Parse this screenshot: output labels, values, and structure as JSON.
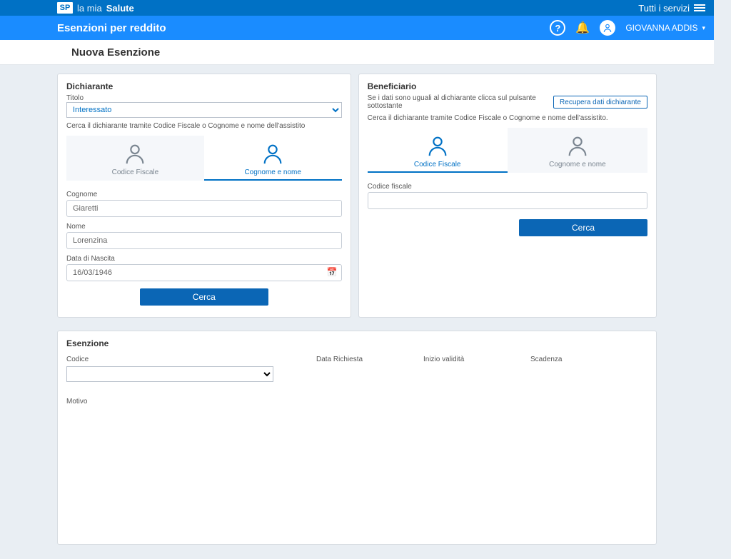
{
  "topbar": {
    "logo_text": "SP",
    "brand_a": "la mia",
    "brand_b": "Salute",
    "all_services": "Tutti i servizi"
  },
  "header": {
    "app_title": "Esenzioni per reddito",
    "user_name": "GIOVANNA ADDIS"
  },
  "subheader": {
    "title": "Nuova Esenzione"
  },
  "dichiarante": {
    "heading": "Dichiarante",
    "titolo_label": "Titolo",
    "titolo_value": "Interessato",
    "search_hint": "Cerca il dichiarante tramite Codice Fiscale o Cognome e nome dell'assistito",
    "tab_cf": "Codice Fiscale",
    "tab_nome": "Cognome e nome",
    "cognome_label": "Cognome",
    "cognome_value": "Giaretti",
    "nome_label": "Nome",
    "nome_value": "Lorenzina",
    "data_nascita_label": "Data di Nascita",
    "data_nascita_value": "16/03/1946",
    "cerca_label": "Cerca"
  },
  "beneficiario": {
    "heading": "Beneficiario",
    "same_hint": "Se i dati sono uguali al dichiarante clicca sul pulsante sottostante",
    "recover_label": "Recupera dati dichiarante",
    "search_hint": "Cerca il dichiarante tramite Codice Fiscale o Cognome e nome dell'assistito.",
    "tab_cf": "Codice Fiscale",
    "tab_nome": "Cognome e nome",
    "cf_label": "Codice fiscale",
    "cf_value": "",
    "cerca_label": "Cerca"
  },
  "esenzione": {
    "heading": "Esenzione",
    "codice_label": "Codice",
    "data_richiesta_label": "Data Richiesta",
    "inizio_validita_label": "Inizio validità",
    "scadenza_label": "Scadenza",
    "motivo_label": "Motivo"
  }
}
